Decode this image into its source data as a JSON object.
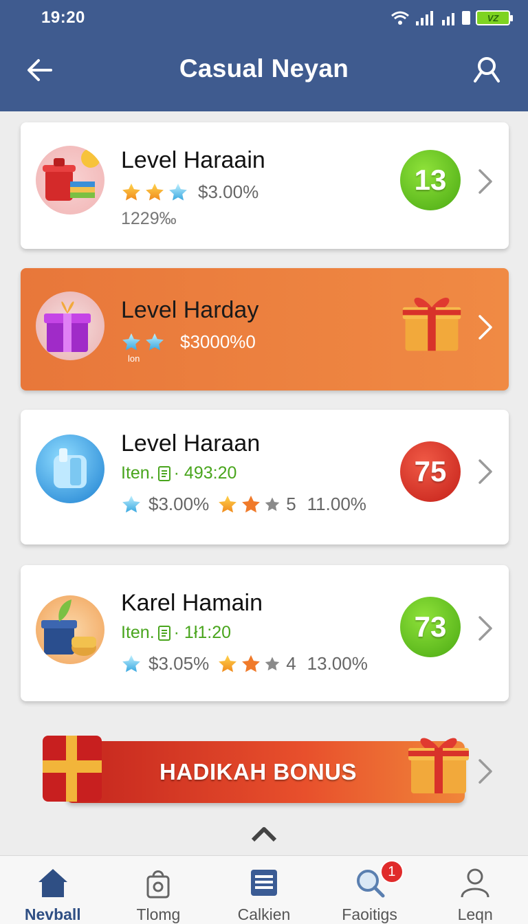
{
  "status": {
    "time": "19:20",
    "battery": "VZ"
  },
  "header": {
    "title": "Casual Neyan"
  },
  "cards": [
    {
      "title": "Level Haraain",
      "value": "$3.00%",
      "sub": "1229‰",
      "badge": "13"
    },
    {
      "title": "Level Harday",
      "value": "$3000%0",
      "tiny": "lon"
    },
    {
      "title": "Level Haraan",
      "item_label": "Iten.",
      "item_value": "· 493:20",
      "value1": "$3.00%",
      "count": "5",
      "value2": "11.00%",
      "badge": "75"
    },
    {
      "title": "Karel Hamain",
      "item_label": "Iten.",
      "item_value": "· 1ł1:20",
      "value1": "$3.05%",
      "count": "4",
      "value2": "13.00%",
      "badge": "73"
    }
  ],
  "bonus": {
    "label": "HADIKAH BONUS"
  },
  "bottom_nav": [
    {
      "label": "Nevball",
      "icon": "home-icon",
      "active": true
    },
    {
      "label": "Tlomg",
      "icon": "bag-icon"
    },
    {
      "label": "Calkien",
      "icon": "list-icon"
    },
    {
      "label": "Faoitigs",
      "icon": "search-icon",
      "badge": "1"
    },
    {
      "label": "Leqn",
      "icon": "user-icon"
    }
  ],
  "colors": {
    "header": "#3f5b8f",
    "highlight": "#e8773a",
    "green_badge": "#4aa913",
    "red_badge": "#c42019",
    "item_green": "#49a51d"
  }
}
